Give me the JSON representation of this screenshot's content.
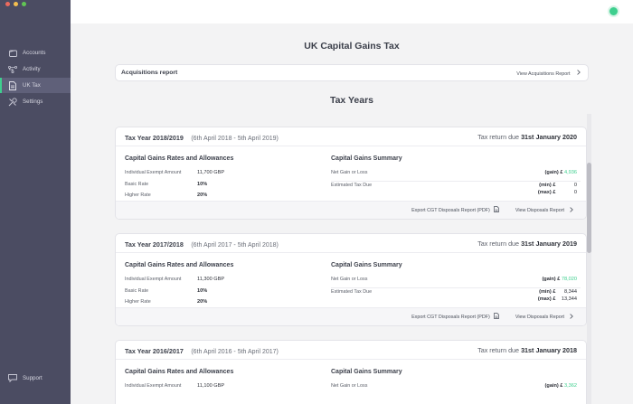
{
  "sidebar": {
    "items": [
      {
        "label": "Accounts",
        "icon": "wallet-icon"
      },
      {
        "label": "Activity",
        "icon": "activity-icon"
      },
      {
        "label": "UK Tax",
        "icon": "document-icon"
      },
      {
        "label": "Settings",
        "icon": "settings-icon"
      }
    ],
    "support_label": "Support",
    "active_item": "UK Tax"
  },
  "status": {
    "color": "#3ecf8e"
  },
  "page": {
    "title": "UK Capital Gains Tax"
  },
  "acquisitions": {
    "title": "Acquisitions report",
    "link": "View Acquisitions Report"
  },
  "tax_years_title": "Tax Years",
  "labels": {
    "rates_title": "Capital Gains Rates and Allowances",
    "summary_title": "Capital Gains Summary",
    "exempt": "Individual Exempt Amount",
    "basic": "Basic Rate",
    "higher": "Higher Rate",
    "net": "Net Gain or Loss",
    "estimated": "Estimated Tax Due",
    "gain": "(gain) £",
    "min": "(min) £",
    "max": "(max) £",
    "export": "Export CGT Disposals Report (PDF)",
    "view": "View Disposals Report",
    "due_prefix": "Tax return due"
  },
  "tax_years": [
    {
      "name": "Tax Year 2018/2019",
      "range": "(6th April 2018 - 5th April 2019)",
      "due": "31st January 2020",
      "exempt": "11,700 GBP",
      "basic": "10%",
      "higher": "20%",
      "gain": "4,936",
      "min": "0",
      "max": "0"
    },
    {
      "name": "Tax Year 2017/2018",
      "range": "(6th April 2017 - 5th April 2018)",
      "due": "31st January 2019",
      "exempt": "11,300 GBP",
      "basic": "10%",
      "higher": "20%",
      "gain": "78,020",
      "min": "8,344",
      "max": "13,344"
    },
    {
      "name": "Tax Year 2016/2017",
      "range": "(6th April 2016 - 5th April 2017)",
      "due": "31st January 2018",
      "exempt": "11,100 GBP",
      "basic": "",
      "higher": "",
      "gain": "3,362",
      "min": "",
      "max": ""
    }
  ]
}
